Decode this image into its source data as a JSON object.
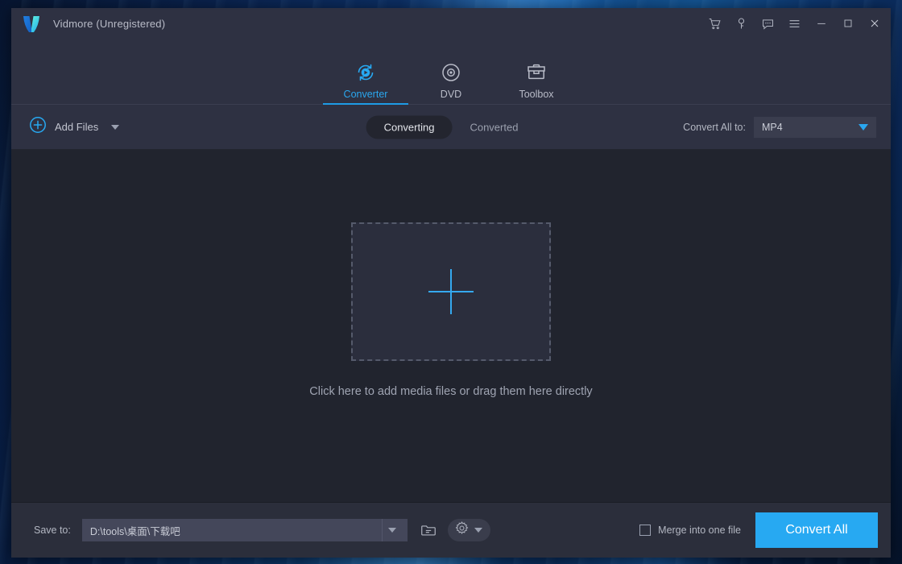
{
  "window": {
    "title": "Vidmore (Unregistered)",
    "logo_icon": "vidmore-v-logo",
    "controls": [
      {
        "name": "cart-icon",
        "label": "Cart"
      },
      {
        "name": "key-icon",
        "label": "Register"
      },
      {
        "name": "feedback-icon",
        "label": "Feedback"
      },
      {
        "name": "menu-icon",
        "label": "Menu"
      },
      {
        "name": "minimize-icon",
        "label": "Minimize"
      },
      {
        "name": "maximize-icon",
        "label": "Maximize"
      },
      {
        "name": "close-icon",
        "label": "Close"
      }
    ]
  },
  "nav": {
    "tabs": [
      {
        "label": "Converter",
        "icon": "converter-icon",
        "active": true
      },
      {
        "label": "DVD",
        "icon": "dvd-disc-icon",
        "active": false
      },
      {
        "label": "Toolbox",
        "icon": "toolbox-icon",
        "active": false
      }
    ]
  },
  "toolbar": {
    "add_files_label": "Add Files",
    "add_files_icon": "plus-circle-icon",
    "add_files_caret": "chevron-down-icon",
    "segments": [
      {
        "label": "Converting",
        "active": true
      },
      {
        "label": "Converted",
        "active": false
      }
    ],
    "convert_all_to_label": "Convert All to:",
    "format_value": "MP4",
    "format_caret": "caret-down-icon"
  },
  "main": {
    "dropzone_icon": "plus-icon",
    "hint": "Click here to add media files or drag them here directly"
  },
  "bottom": {
    "save_to_label": "Save to:",
    "save_to_path": "D:\\tools\\桌面\\下载吧",
    "path_caret": "caret-down-icon",
    "browse_icon": "folder-icon",
    "settings_icon": "gear-icon",
    "settings_caret": "caret-down-icon",
    "merge_label": "Merge into one file",
    "merge_checked": false,
    "convert_all_label": "Convert All"
  },
  "colors": {
    "accent": "#27a9f2",
    "titlebar": "#2e3142",
    "content": "#21242e",
    "bottombar": "#2b2e3b"
  }
}
